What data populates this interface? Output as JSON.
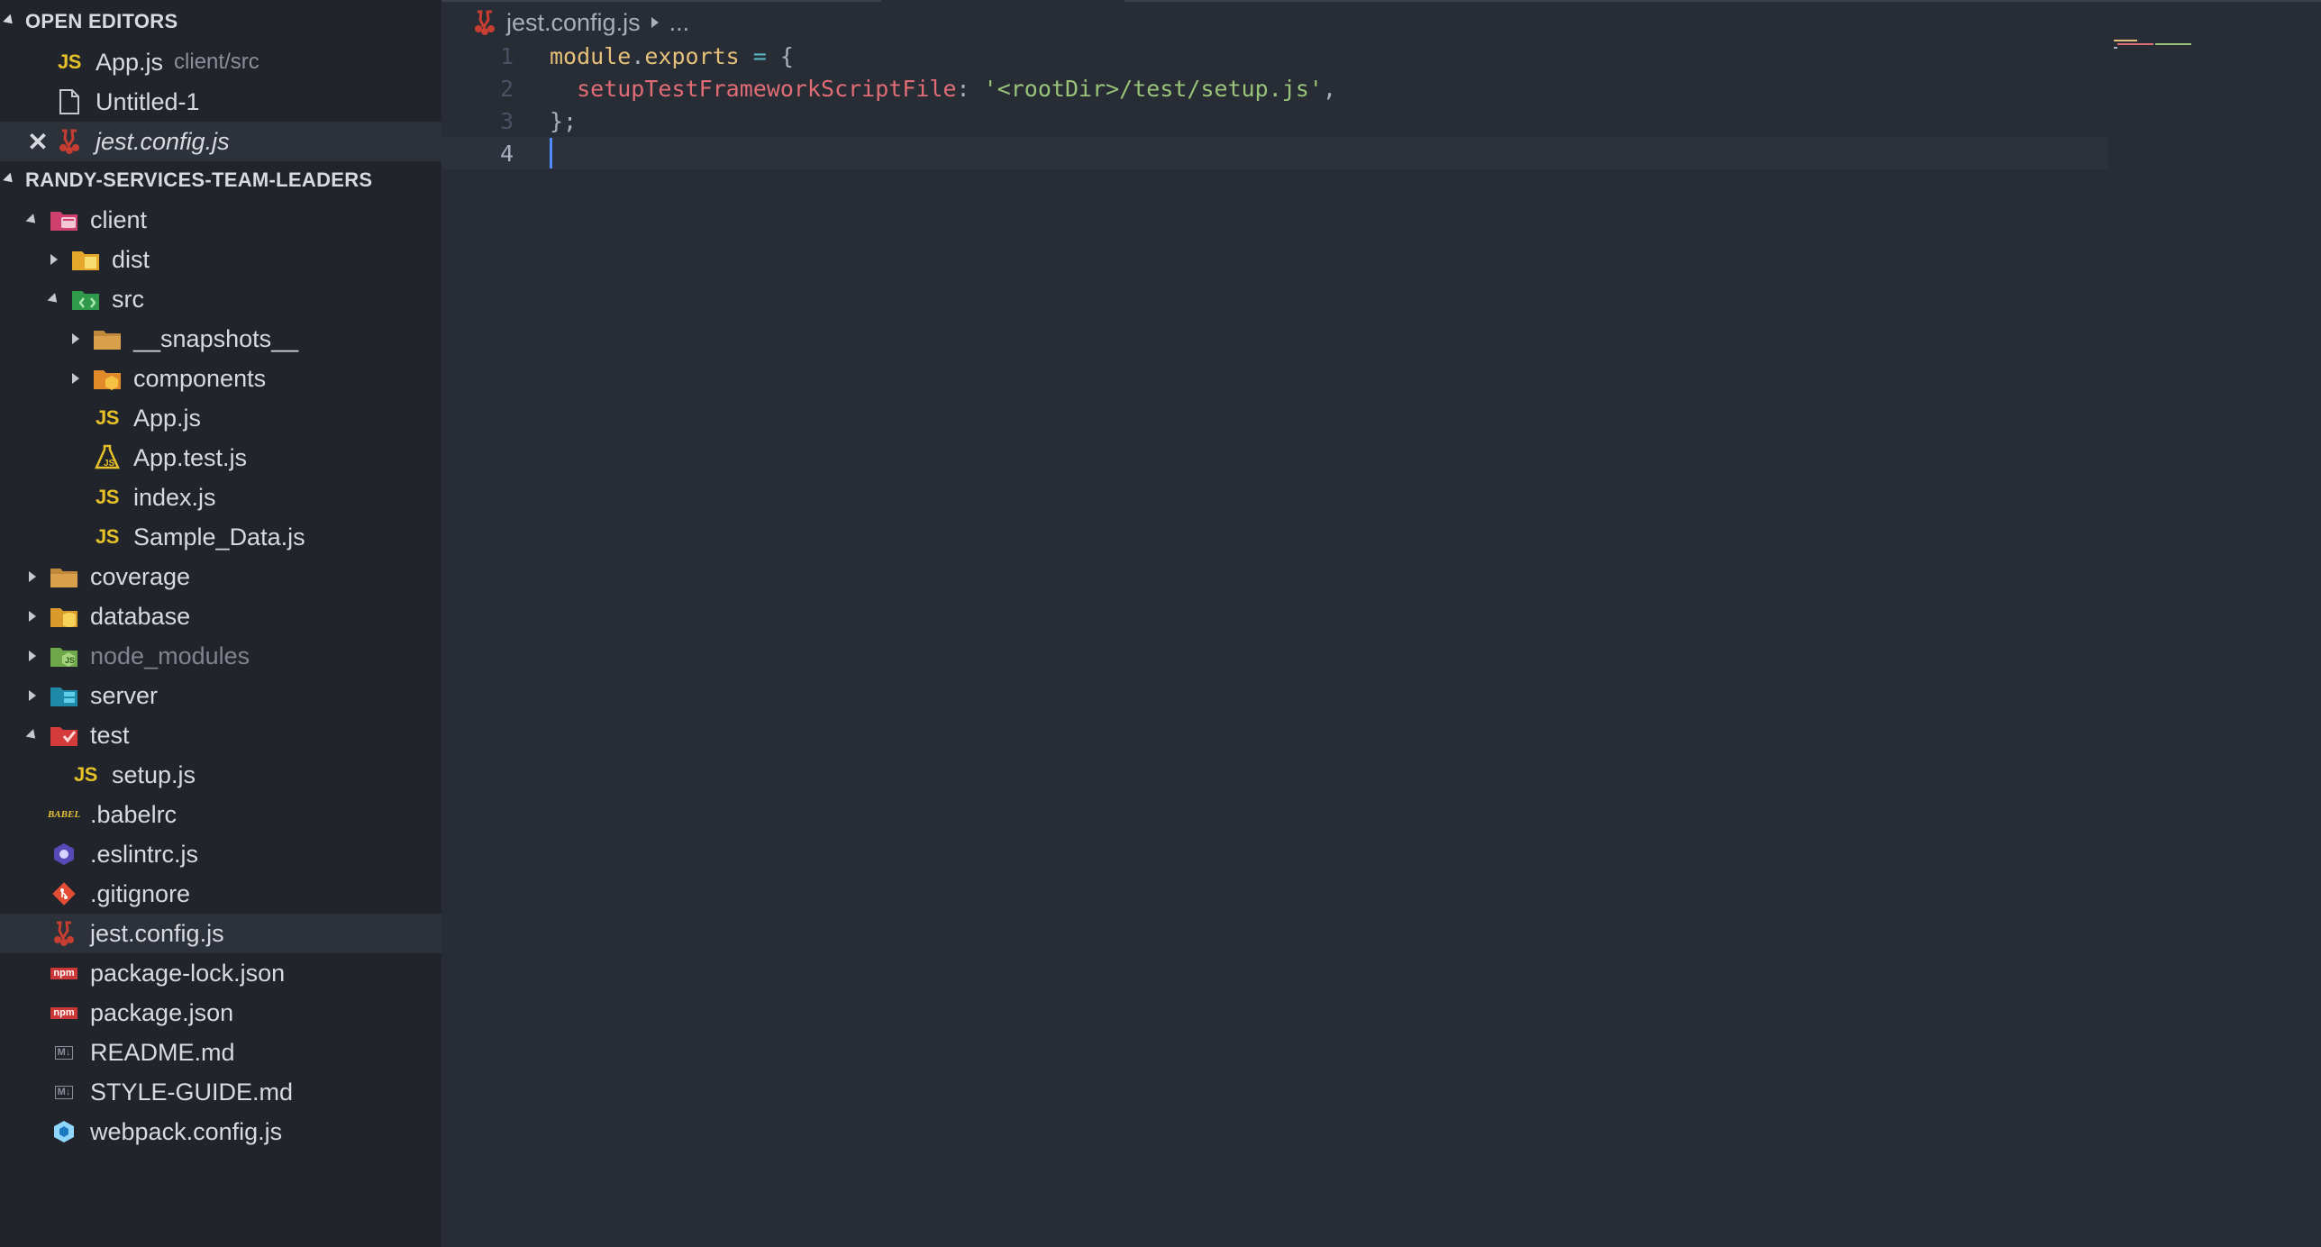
{
  "colors": {
    "sidebar_bg": "#21252b",
    "editor_bg": "#282c34",
    "js_yellow": "#e5c028",
    "string_green": "#98c379",
    "property_red": "#e06c75",
    "keyword_gold": "#e5c07b",
    "cursor_blue": "#528bff"
  },
  "open_editors": {
    "header": "OPEN EDITORS",
    "items": [
      {
        "label": "App.js",
        "desc": "client/src",
        "icon": "js-icon"
      },
      {
        "label": "Untitled-1",
        "icon": "file-icon"
      },
      {
        "label": "jest.config.js",
        "icon": "jest-icon",
        "close": "✕"
      }
    ]
  },
  "explorer": {
    "header": "RANDY-SERVICES-TEAM-LEADERS",
    "items": [
      {
        "label": "client",
        "icon": "folder-client-icon"
      },
      {
        "label": "dist",
        "icon": "folder-dist-icon"
      },
      {
        "label": "src",
        "icon": "folder-src-icon"
      },
      {
        "label": "__snapshots__",
        "icon": "folder-icon"
      },
      {
        "label": "components",
        "icon": "folder-components-icon"
      },
      {
        "label": "App.js",
        "icon": "js-icon",
        "icon_text": "JS"
      },
      {
        "label": "App.test.js",
        "icon": "test-js-icon"
      },
      {
        "label": "index.js",
        "icon": "js-icon",
        "icon_text": "JS"
      },
      {
        "label": "Sample_Data.js",
        "icon": "js-icon",
        "icon_text": "JS"
      },
      {
        "label": "coverage",
        "icon": "folder-icon"
      },
      {
        "label": "database",
        "icon": "folder-database-icon"
      },
      {
        "label": "node_modules",
        "icon": "folder-node-icon"
      },
      {
        "label": "server",
        "icon": "folder-server-icon"
      },
      {
        "label": "test",
        "icon": "folder-test-icon"
      },
      {
        "label": "setup.js",
        "icon": "js-icon",
        "icon_text": "JS"
      },
      {
        "label": ".babelrc",
        "icon": "babel-icon",
        "icon_text": "BABEL"
      },
      {
        "label": ".eslintrc.js",
        "icon": "eslint-icon"
      },
      {
        "label": ".gitignore",
        "icon": "git-icon"
      },
      {
        "label": "jest.config.js",
        "icon": "jest-icon"
      },
      {
        "label": "package-lock.json",
        "icon": "npm-icon",
        "icon_text": "npm"
      },
      {
        "label": "package.json",
        "icon": "npm-icon",
        "icon_text": "npm"
      },
      {
        "label": "README.md",
        "icon": "markdown-icon",
        "icon_text": "M↓"
      },
      {
        "label": "STYLE-GUIDE.md",
        "icon": "markdown-icon",
        "icon_text": "M↓"
      },
      {
        "label": "webpack.config.js",
        "icon": "webpack-icon"
      }
    ]
  },
  "editor": {
    "breadcrumb_file": "jest.config.js",
    "breadcrumb_more": "...",
    "lines": [
      {
        "num": "1",
        "tokens": [
          [
            "kw",
            "module"
          ],
          [
            "punc",
            "."
          ],
          [
            "kw",
            "exports"
          ],
          [
            "op",
            " = "
          ],
          [
            "punc",
            "{"
          ]
        ]
      },
      {
        "num": "2",
        "tokens": [
          [
            "prop",
            "  setupTestFrameworkScriptFile"
          ],
          [
            "punc",
            ": "
          ],
          [
            "str",
            "'<rootDir>/test/setup.js'"
          ],
          [
            "punc",
            ","
          ]
        ]
      },
      {
        "num": "3",
        "tokens": [
          [
            "punc",
            "};"
          ]
        ]
      },
      {
        "num": "4",
        "tokens": []
      }
    ]
  }
}
